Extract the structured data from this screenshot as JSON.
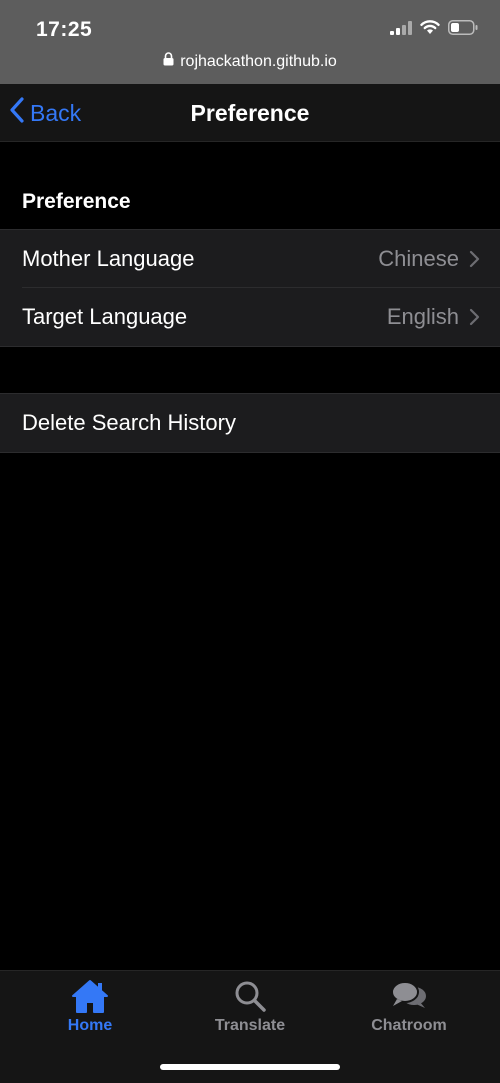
{
  "status_bar": {
    "time": "17:25"
  },
  "browser": {
    "url": "rojhackathon.github.io"
  },
  "navbar": {
    "back_label": "Back",
    "title": "Preference"
  },
  "preference_section": {
    "header": "Preference",
    "rows": [
      {
        "label": "Mother Language",
        "value": "Chinese"
      },
      {
        "label": "Target Language",
        "value": "English"
      }
    ]
  },
  "actions_section": {
    "rows": [
      {
        "label": "Delete Search History"
      }
    ]
  },
  "tabbar": {
    "tabs": [
      {
        "label": "Home",
        "icon": "home-icon",
        "active": true
      },
      {
        "label": "Translate",
        "icon": "search-icon",
        "active": false
      },
      {
        "label": "Chatroom",
        "icon": "chat-bubbles-icon",
        "active": false
      }
    ]
  },
  "colors": {
    "accent": "#3478f6",
    "background": "#000000",
    "cell_background": "#1c1c1e",
    "secondary_text": "#8e8e93"
  }
}
